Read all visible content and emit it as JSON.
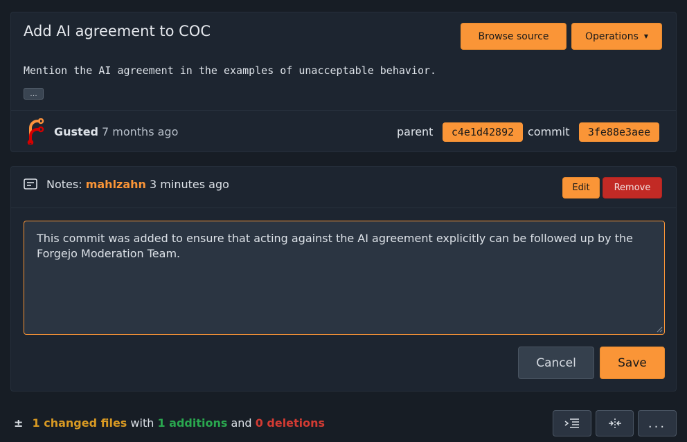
{
  "commit": {
    "title": "Add AI agreement to COC",
    "browse_label": "Browse source",
    "operations_label": "Operations",
    "message": "Mention the AI agreement in the examples of unacceptable behavior.",
    "ellipsis": "...",
    "author": "Gusted",
    "time": "7 months ago",
    "parent_label": "parent",
    "parent_sha": "c4e1d42892",
    "commit_label": "commit",
    "commit_sha": "3fe88e3aee"
  },
  "notes": {
    "label": "Notes:",
    "user": "mahlzahn",
    "time": "3 minutes ago",
    "edit_label": "Edit",
    "remove_label": "Remove",
    "text": "This commit was added to ensure that acting against the AI agreement explicitly can be followed up by the Forgejo Moderation Team.",
    "cancel_label": "Cancel",
    "save_label": "Save"
  },
  "diff_stats": {
    "changed": "1 changed files",
    "with": "with",
    "additions": "1 additions",
    "and": "and",
    "deletions": "0 deletions"
  },
  "toolbar": {
    "more_label": "..."
  },
  "colors": {
    "accent": "#fa9537",
    "danger": "#c22a25",
    "addition": "#2aa84f",
    "deletion": "#d33b33",
    "changed": "#d99a23"
  },
  "icons": {
    "logo": "forgejo-logo-icon",
    "note": "note-icon",
    "diff_stat": "plus-minus-icon",
    "list": "list-indent-icon",
    "split": "split-view-icon",
    "more": "kebab-horizontal-icon"
  }
}
